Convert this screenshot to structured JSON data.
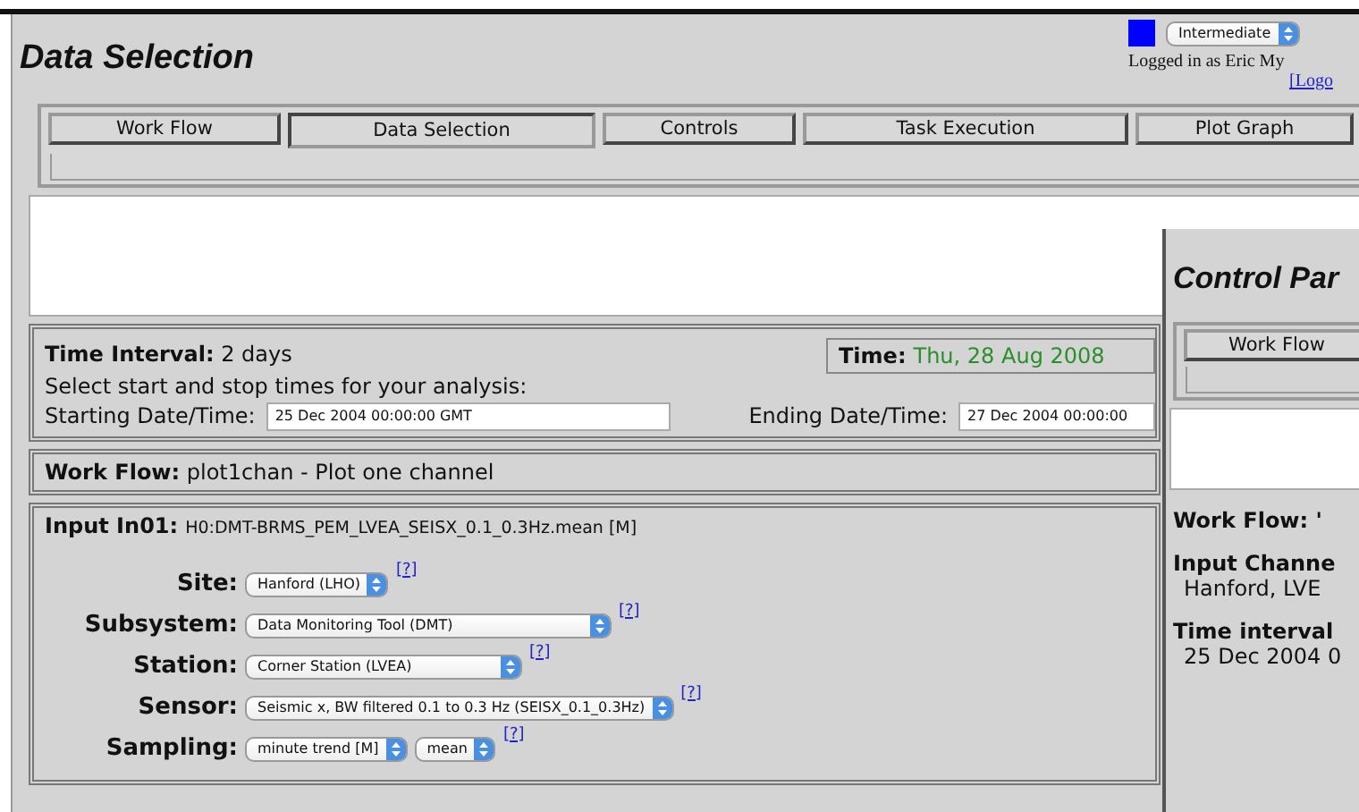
{
  "window": {
    "title": "Data Selection"
  },
  "header": {
    "level_select": "Intermediate",
    "login_text": "Logged in as Eric My",
    "logout_link": "[Logo"
  },
  "tabs": [
    {
      "label": "Work Flow",
      "selected": false
    },
    {
      "label": "Data Selection",
      "selected": true
    },
    {
      "label": "Controls",
      "selected": false
    },
    {
      "label": "Task Execution",
      "selected": false
    },
    {
      "label": "Plot Graph",
      "selected": false
    }
  ],
  "time_panel": {
    "interval": "**Time Interval:** 2 days",
    "clock_label": "Time:",
    "clock_value": "Thu, 28 Aug 2008",
    "instruction": "Select start and stop times for your analysis:",
    "start_label": "Starting Date/Time:",
    "start_value": "25 Dec 2004 00:00:00 GMT",
    "end_label": "Ending Date/Time:",
    "end_value": "27 Dec 2004 00:00:00"
  },
  "workflow": "**Work Flow:** plot1chan - Plot one channel",
  "input": {
    "label": "Input In01:",
    "channel": "H0:DMT-BRMS_PEM_LVEA_SEISX_0.1_0.3Hz.mean [M]",
    "fields": [
      {
        "label": "Site:",
        "selects": [
          "Hanford (LHO)"
        ],
        "help": "[?]"
      },
      {
        "label": "Subsystem:",
        "selects": [
          "Data Monitoring Tool (DMT)"
        ],
        "help": "[?]"
      },
      {
        "label": "Station:",
        "selects": [
          "Corner Station (LVEA)"
        ],
        "help": "[?]"
      },
      {
        "label": "Sensor:",
        "selects": [
          "Seismic x, BW filtered 0.1 to 0.3 Hz (SEISX_0.1_0.3Hz)"
        ],
        "help": "[?]"
      },
      {
        "label": "Sampling:",
        "selects": [
          "minute trend [M]",
          "mean"
        ],
        "help": "[?]"
      }
    ]
  },
  "control_panel": {
    "title": "Control Par",
    "tabs": [
      {
        "label": "Work Flow",
        "selected": false
      }
    ],
    "lines": [
      {
        "kind": "heading",
        "text": "Work Flow: '"
      },
      {
        "kind": "heading",
        "text": "Input Channe"
      },
      {
        "kind": "value",
        "text": "Hanford, LVE"
      },
      {
        "kind": "heading",
        "text": "Time interval"
      },
      {
        "kind": "value",
        "text": "25 Dec 2004 0"
      }
    ]
  }
}
